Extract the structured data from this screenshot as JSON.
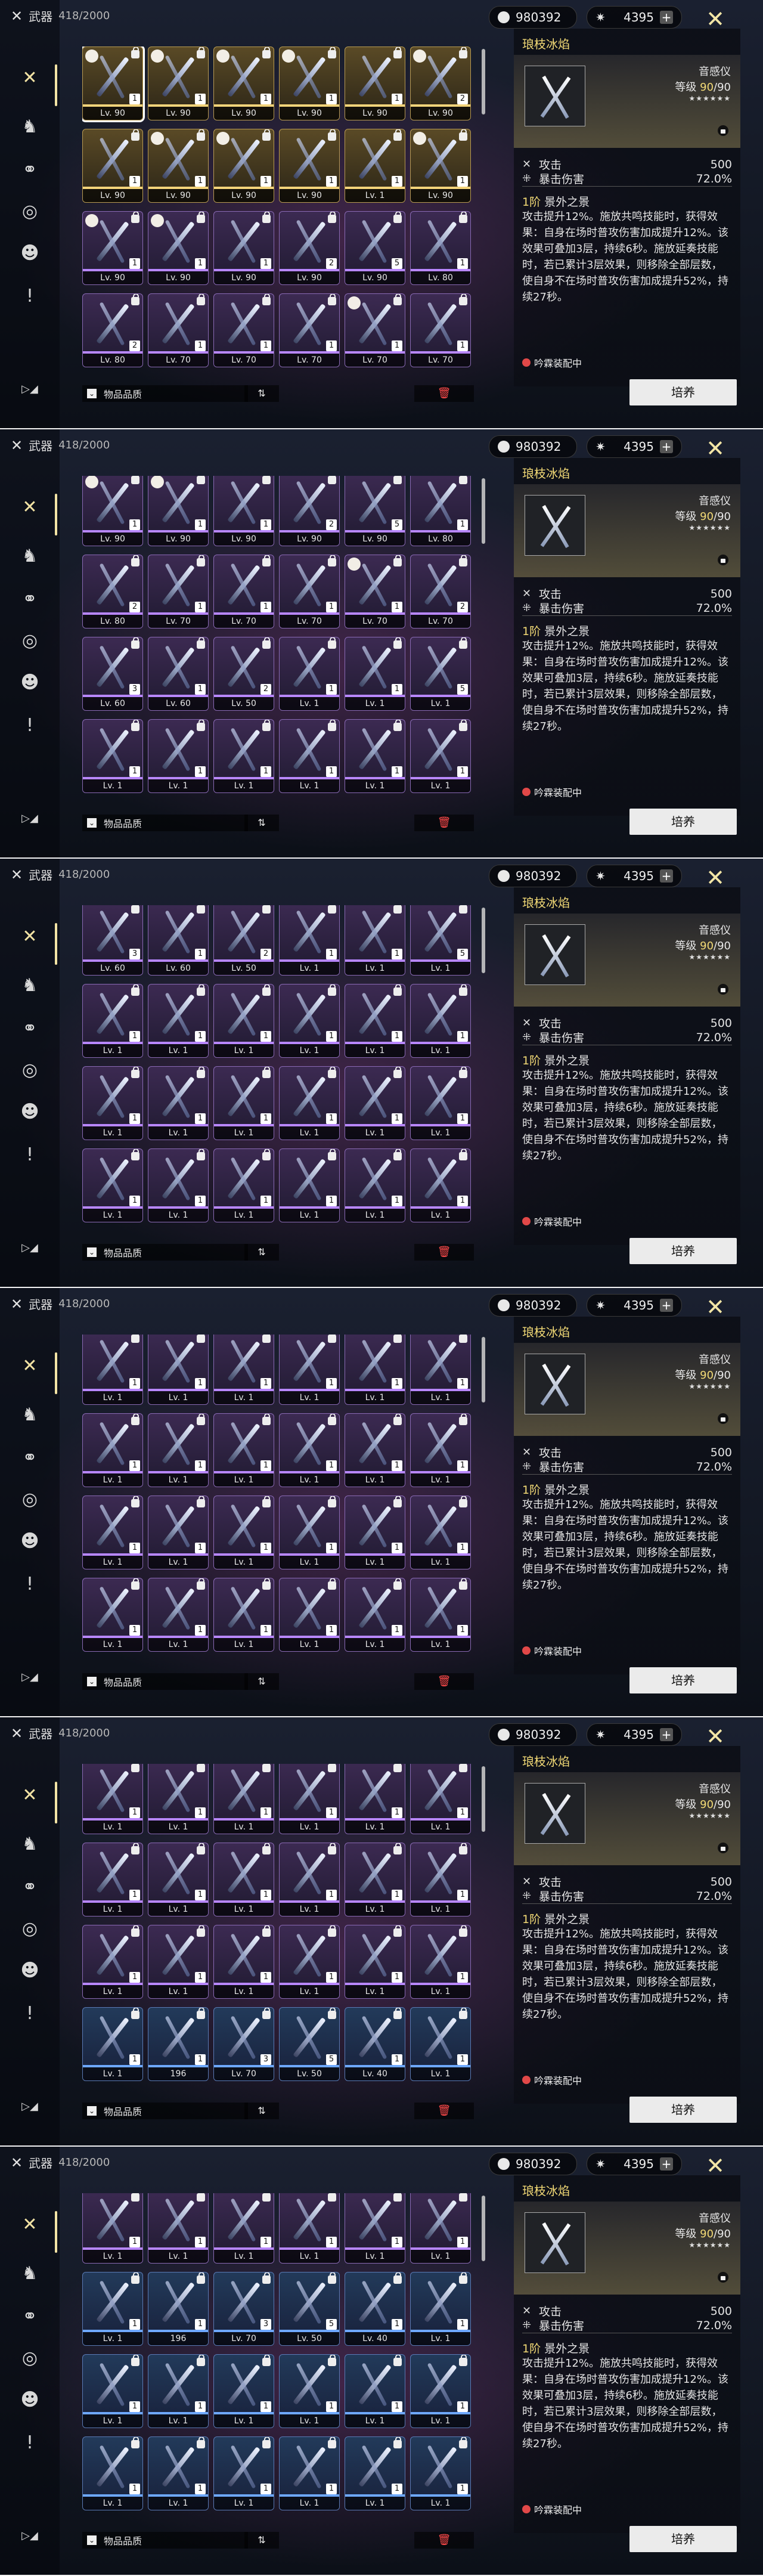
{
  "header": {
    "title": "武器",
    "count": "418/2000"
  },
  "currency": [
    {
      "icon": "coin-icon",
      "value": "980392"
    },
    {
      "icon": "star-icon",
      "value": "4395"
    }
  ],
  "close_icon": "close-icon",
  "filter": {
    "label": "物品品质"
  },
  "detail": {
    "name": "琅枝冰焰",
    "type": "音感仪",
    "level_label": "等级",
    "level_current": "90",
    "level_max": "/90",
    "stars": "★★★★★★",
    "stats": [
      {
        "icon": "attack-icon",
        "name": "攻击",
        "value": "500"
      },
      {
        "icon": "crit-damage-icon",
        "name": "暴击伤害",
        "value": "72.0%"
      }
    ],
    "skill_rank": "1阶",
    "skill_name": "景外之景",
    "skill_desc": "攻击提升12%。施放共鸣技能时，获得效果：自身在场时普攻伤害加成提升12%。该效果可叠加3层，持续6秒。施放延奏技能时，若已累计3层效果，则移除全部层数，使自身不在场时普攻伤害加成提升52%，持续27秒。",
    "equipped_tag": "吟霖装配中"
  },
  "cultivate_label": "培养",
  "panels": [
    {
      "rows": [
        [
          {
            "lv": "Lv. 90",
            "r": 5,
            "rank": "1",
            "eq": true,
            "sel": true
          },
          {
            "lv": "Lv. 90",
            "r": 5,
            "rank": "1",
            "eq": true
          },
          {
            "lv": "Lv. 90",
            "r": 5,
            "rank": "1",
            "eq": true
          },
          {
            "lv": "Lv. 90",
            "r": 5,
            "rank": "1",
            "eq": true
          },
          {
            "lv": "Lv. 90",
            "r": 5,
            "rank": "1"
          },
          {
            "lv": "Lv. 90",
            "r": 5,
            "rank": "2",
            "eq": true
          }
        ],
        [
          {
            "lv": "Lv. 90",
            "r": 5,
            "rank": "1"
          },
          {
            "lv": "Lv. 90",
            "r": 5,
            "rank": "1",
            "eq": true
          },
          {
            "lv": "Lv. 90",
            "r": 5,
            "rank": "1",
            "eq": true
          },
          {
            "lv": "Lv. 90",
            "r": 5,
            "rank": "1"
          },
          {
            "lv": "Lv. 1",
            "r": 5,
            "rank": "1"
          },
          {
            "lv": "Lv. 90",
            "r": 5,
            "rank": "1",
            "eq": true
          }
        ],
        [
          {
            "lv": "Lv. 90",
            "r": 4,
            "rank": "1",
            "eq": true
          },
          {
            "lv": "Lv. 90",
            "r": 4,
            "rank": "1",
            "eq": true
          },
          {
            "lv": "Lv. 90",
            "r": 4,
            "rank": "1"
          },
          {
            "lv": "Lv. 90",
            "r": 4,
            "rank": "2"
          },
          {
            "lv": "Lv. 90",
            "r": 4,
            "rank": "5"
          },
          {
            "lv": "Lv. 80",
            "r": 4,
            "rank": "1"
          }
        ],
        [
          {
            "lv": "Lv. 80",
            "r": 4,
            "rank": "2"
          },
          {
            "lv": "Lv. 70",
            "r": 4,
            "rank": "1"
          },
          {
            "lv": "Lv. 70",
            "r": 4,
            "rank": "1"
          },
          {
            "lv": "Lv. 70",
            "r": 4,
            "rank": "1"
          },
          {
            "lv": "Lv. 70",
            "r": 4,
            "rank": "1",
            "eq": true
          },
          {
            "lv": "Lv. 70",
            "r": 4,
            "rank": "1"
          }
        ]
      ]
    },
    {
      "rows": [
        [
          {
            "lv": "Lv. 90",
            "r": 4,
            "rank": "1",
            "eq": true
          },
          {
            "lv": "Lv. 90",
            "r": 4,
            "rank": "1",
            "eq": true
          },
          {
            "lv": "Lv. 90",
            "r": 4,
            "rank": "1"
          },
          {
            "lv": "Lv. 90",
            "r": 4,
            "rank": "2"
          },
          {
            "lv": "Lv. 90",
            "r": 4,
            "rank": "5"
          },
          {
            "lv": "Lv. 80",
            "r": 4,
            "rank": "1"
          }
        ],
        [
          {
            "lv": "Lv. 80",
            "r": 4,
            "rank": "2"
          },
          {
            "lv": "Lv. 70",
            "r": 4,
            "rank": "1"
          },
          {
            "lv": "Lv. 70",
            "r": 4,
            "rank": "1"
          },
          {
            "lv": "Lv. 70",
            "r": 4,
            "rank": "1"
          },
          {
            "lv": "Lv. 70",
            "r": 4,
            "rank": "1",
            "eq": true
          },
          {
            "lv": "Lv. 70",
            "r": 4,
            "rank": "2"
          }
        ],
        [
          {
            "lv": "Lv. 60",
            "r": 4,
            "rank": "3"
          },
          {
            "lv": "Lv. 60",
            "r": 4,
            "rank": "1"
          },
          {
            "lv": "Lv. 50",
            "r": 4,
            "rank": "2"
          },
          {
            "lv": "Lv. 1",
            "r": 4,
            "rank": "1"
          },
          {
            "lv": "Lv. 1",
            "r": 4,
            "rank": "1"
          },
          {
            "lv": "Lv. 1",
            "r": 4,
            "rank": "5"
          }
        ],
        [
          {
            "lv": "Lv. 1",
            "r": 4,
            "rank": "1"
          },
          {
            "lv": "Lv. 1",
            "r": 4,
            "rank": "1"
          },
          {
            "lv": "Lv. 1",
            "r": 4,
            "rank": "1"
          },
          {
            "lv": "Lv. 1",
            "r": 4,
            "rank": "1"
          },
          {
            "lv": "Lv. 1",
            "r": 4,
            "rank": "1"
          },
          {
            "lv": "Lv. 1",
            "r": 4,
            "rank": "1"
          }
        ]
      ]
    },
    {
      "rows": [
        [
          {
            "lv": "Lv. 60",
            "r": 4,
            "rank": "3"
          },
          {
            "lv": "Lv. 60",
            "r": 4,
            "rank": "1"
          },
          {
            "lv": "Lv. 50",
            "r": 4,
            "rank": "2"
          },
          {
            "lv": "Lv. 1",
            "r": 4,
            "rank": "1"
          },
          {
            "lv": "Lv. 1",
            "r": 4,
            "rank": "1"
          },
          {
            "lv": "Lv. 1",
            "r": 4,
            "rank": "5"
          }
        ],
        [
          {
            "lv": "Lv. 1",
            "r": 4,
            "rank": "1"
          },
          {
            "lv": "Lv. 1",
            "r": 4,
            "rank": "1"
          },
          {
            "lv": "Lv. 1",
            "r": 4,
            "rank": "1"
          },
          {
            "lv": "Lv. 1",
            "r": 4,
            "rank": "1"
          },
          {
            "lv": "Lv. 1",
            "r": 4,
            "rank": "1"
          },
          {
            "lv": "Lv. 1",
            "r": 4,
            "rank": "1"
          }
        ],
        [
          {
            "lv": "Lv. 1",
            "r": 4,
            "rank": "1"
          },
          {
            "lv": "Lv. 1",
            "r": 4,
            "rank": "1"
          },
          {
            "lv": "Lv. 1",
            "r": 4,
            "rank": "1"
          },
          {
            "lv": "Lv. 1",
            "r": 4,
            "rank": "1"
          },
          {
            "lv": "Lv. 1",
            "r": 4,
            "rank": "1"
          },
          {
            "lv": "Lv. 1",
            "r": 4,
            "rank": "1"
          }
        ],
        [
          {
            "lv": "Lv. 1",
            "r": 4,
            "rank": "1"
          },
          {
            "lv": "Lv. 1",
            "r": 4,
            "rank": "1"
          },
          {
            "lv": "Lv. 1",
            "r": 4,
            "rank": "1"
          },
          {
            "lv": "Lv. 1",
            "r": 4,
            "rank": "1"
          },
          {
            "lv": "Lv. 1",
            "r": 4,
            "rank": "1"
          },
          {
            "lv": "Lv. 1",
            "r": 4,
            "rank": "1"
          }
        ]
      ]
    },
    {
      "rows": [
        [
          {
            "lv": "Lv. 1",
            "r": 4,
            "rank": "1"
          },
          {
            "lv": "Lv. 1",
            "r": 4,
            "rank": "1"
          },
          {
            "lv": "Lv. 1",
            "r": 4,
            "rank": "1"
          },
          {
            "lv": "Lv. 1",
            "r": 4,
            "rank": "1"
          },
          {
            "lv": "Lv. 1",
            "r": 4,
            "rank": "1"
          },
          {
            "lv": "Lv. 1",
            "r": 4,
            "rank": "1"
          }
        ],
        [
          {
            "lv": "Lv. 1",
            "r": 4,
            "rank": "1"
          },
          {
            "lv": "Lv. 1",
            "r": 4,
            "rank": "1"
          },
          {
            "lv": "Lv. 1",
            "r": 4,
            "rank": "1"
          },
          {
            "lv": "Lv. 1",
            "r": 4,
            "rank": "1"
          },
          {
            "lv": "Lv. 1",
            "r": 4,
            "rank": "1"
          },
          {
            "lv": "Lv. 1",
            "r": 4,
            "rank": "1"
          }
        ],
        [
          {
            "lv": "Lv. 1",
            "r": 4,
            "rank": "1"
          },
          {
            "lv": "Lv. 1",
            "r": 4,
            "rank": "1"
          },
          {
            "lv": "Lv. 1",
            "r": 4,
            "rank": "1"
          },
          {
            "lv": "Lv. 1",
            "r": 4,
            "rank": "1"
          },
          {
            "lv": "Lv. 1",
            "r": 4,
            "rank": "1"
          },
          {
            "lv": "Lv. 1",
            "r": 4,
            "rank": "1"
          }
        ],
        [
          {
            "lv": "Lv. 1",
            "r": 4,
            "rank": "1"
          },
          {
            "lv": "Lv. 1",
            "r": 4,
            "rank": "1"
          },
          {
            "lv": "Lv. 1",
            "r": 4,
            "rank": "1"
          },
          {
            "lv": "Lv. 1",
            "r": 4,
            "rank": "1"
          },
          {
            "lv": "Lv. 1",
            "r": 4,
            "rank": "1"
          },
          {
            "lv": "Lv. 1",
            "r": 4,
            "rank": "1"
          }
        ]
      ]
    },
    {
      "rows": [
        [
          {
            "lv": "Lv. 1",
            "r": 4,
            "rank": "1"
          },
          {
            "lv": "Lv. 1",
            "r": 4,
            "rank": "1"
          },
          {
            "lv": "Lv. 1",
            "r": 4,
            "rank": "1"
          },
          {
            "lv": "Lv. 1",
            "r": 4,
            "rank": "1"
          },
          {
            "lv": "Lv. 1",
            "r": 4,
            "rank": "1"
          },
          {
            "lv": "Lv. 1",
            "r": 4,
            "rank": "1"
          }
        ],
        [
          {
            "lv": "Lv. 1",
            "r": 4,
            "rank": "1"
          },
          {
            "lv": "Lv. 1",
            "r": 4,
            "rank": "1"
          },
          {
            "lv": "Lv. 1",
            "r": 4,
            "rank": "1"
          },
          {
            "lv": "Lv. 1",
            "r": 4,
            "rank": "1"
          },
          {
            "lv": "Lv. 1",
            "r": 4,
            "rank": "1"
          },
          {
            "lv": "Lv. 1",
            "r": 4,
            "rank": "1"
          }
        ],
        [
          {
            "lv": "Lv. 1",
            "r": 4,
            "rank": "1"
          },
          {
            "lv": "Lv. 1",
            "r": 4,
            "rank": "1"
          },
          {
            "lv": "Lv. 1",
            "r": 4,
            "rank": "1"
          },
          {
            "lv": "Lv. 1",
            "r": 4,
            "rank": "1"
          },
          {
            "lv": "Lv. 1",
            "r": 4,
            "rank": "1"
          },
          {
            "lv": "Lv. 1",
            "r": 4,
            "rank": "1"
          }
        ],
        [
          {
            "lv": "Lv. 1",
            "r": 3,
            "rank": "1"
          },
          {
            "lv": "196",
            "r": 3,
            "rank": "1"
          },
          {
            "lv": "Lv. 70",
            "r": 3,
            "rank": "3"
          },
          {
            "lv": "Lv. 50",
            "r": 3,
            "rank": "5"
          },
          {
            "lv": "Lv. 40",
            "r": 3,
            "rank": "1"
          },
          {
            "lv": "Lv. 1",
            "r": 3,
            "rank": "1"
          }
        ]
      ]
    },
    {
      "rows": [
        [
          {
            "lv": "Lv. 1",
            "r": 4,
            "rank": "1"
          },
          {
            "lv": "Lv. 1",
            "r": 4,
            "rank": "1"
          },
          {
            "lv": "Lv. 1",
            "r": 4,
            "rank": "1"
          },
          {
            "lv": "Lv. 1",
            "r": 4,
            "rank": "1"
          },
          {
            "lv": "Lv. 1",
            "r": 4,
            "rank": "1"
          },
          {
            "lv": "Lv. 1",
            "r": 4,
            "rank": "1"
          }
        ],
        [
          {
            "lv": "Lv. 1",
            "r": 3,
            "rank": "1"
          },
          {
            "lv": "196",
            "r": 3,
            "rank": "1"
          },
          {
            "lv": "Lv. 70",
            "r": 3,
            "rank": "3"
          },
          {
            "lv": "Lv. 50",
            "r": 3,
            "rank": "5"
          },
          {
            "lv": "Lv. 40",
            "r": 3,
            "rank": "1"
          },
          {
            "lv": "Lv. 1",
            "r": 3,
            "rank": "1"
          }
        ],
        [
          {
            "lv": "Lv. 1",
            "r": 3,
            "rank": "1"
          },
          {
            "lv": "Lv. 1",
            "r": 3,
            "rank": "1"
          },
          {
            "lv": "Lv. 1",
            "r": 3,
            "rank": "1"
          },
          {
            "lv": "Lv. 1",
            "r": 3,
            "rank": "1"
          },
          {
            "lv": "Lv. 1",
            "r": 3,
            "rank": "1"
          },
          {
            "lv": "Lv. 1",
            "r": 3,
            "rank": "1"
          }
        ],
        [
          {
            "lv": "Lv. 1",
            "r": 3,
            "rank": "1"
          },
          {
            "lv": "Lv. 1",
            "r": 3,
            "rank": "1"
          },
          {
            "lv": "Lv. 1",
            "r": 3,
            "rank": "1"
          },
          {
            "lv": "Lv. 1",
            "r": 3,
            "rank": "1"
          },
          {
            "lv": "Lv. 1",
            "r": 3,
            "rank": "1"
          },
          {
            "lv": "Lv. 1",
            "r": 3,
            "rank": "1"
          }
        ]
      ]
    }
  ],
  "rail_icons": [
    "weapon-icon",
    "echo-icon",
    "chain-icon",
    "device-icon",
    "mask-icon",
    "alert-icon"
  ]
}
